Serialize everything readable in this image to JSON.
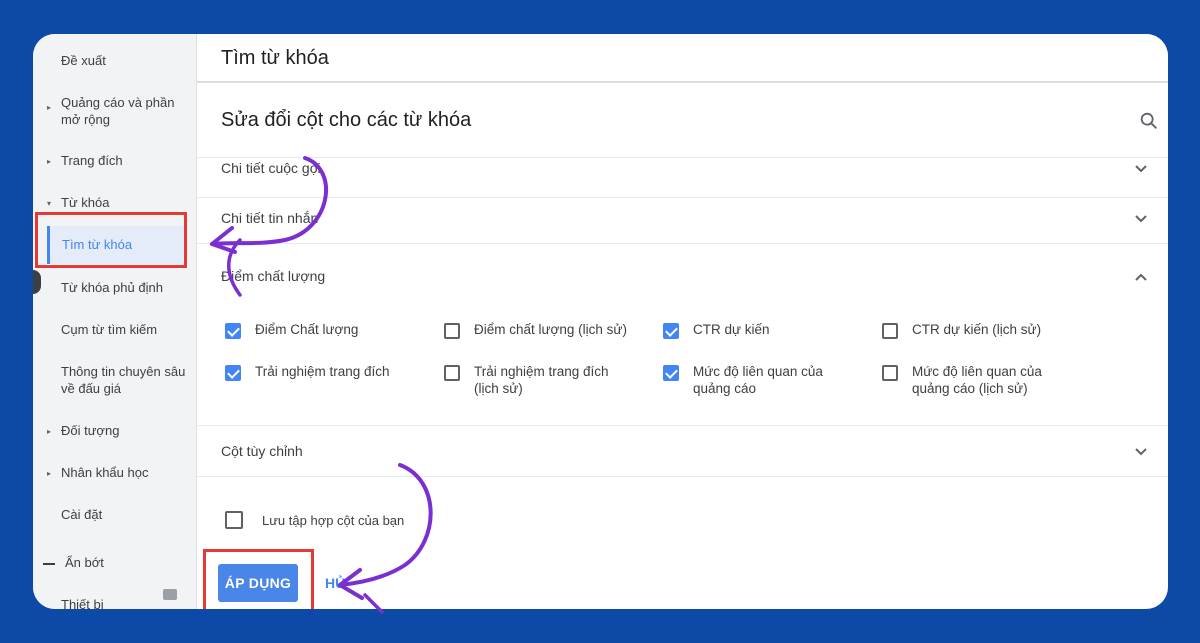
{
  "sidebar": {
    "items": [
      {
        "label": "Đề xuất",
        "arrow": ""
      },
      {
        "label": "Quảng cáo và phần mở rộng",
        "arrow": "▸"
      },
      {
        "label": "Trang đích",
        "arrow": "▸"
      },
      {
        "label": "Từ khóa",
        "arrow": "▾"
      },
      {
        "label": "Từ khóa phủ định",
        "arrow": ""
      },
      {
        "label": "Cụm từ tìm kiếm",
        "arrow": ""
      },
      {
        "label": "Thông tin chuyên sâu về đấu giá",
        "arrow": ""
      },
      {
        "label": "Đối tượng",
        "arrow": "▸"
      },
      {
        "label": "Nhân khẩu học",
        "arrow": "▸"
      },
      {
        "label": "Cài đặt",
        "arrow": ""
      }
    ],
    "active_item": "Tìm từ khóa",
    "hide_label": "Ẩn bớt",
    "partial_item": "Thiết bị"
  },
  "topbar": {
    "title": "Tìm từ khóa"
  },
  "panel": {
    "title": "Sửa đổi cột cho các từ khóa",
    "sections": {
      "call_details": "Chi tiết cuộc gọi",
      "message_details": "Chi tiết tin nhắn",
      "quality_score": "Điểm chất lượng",
      "custom_columns": "Cột tùy chỉnh"
    },
    "options": [
      {
        "label": "Điểm Chất lượng",
        "checked": true
      },
      {
        "label": "Điểm chất lượng (lịch sử)",
        "checked": false
      },
      {
        "label": "CTR dự kiến",
        "checked": true
      },
      {
        "label": "CTR dự kiến (lịch sử)",
        "checked": false
      },
      {
        "label": "Trải nghiệm trang đích",
        "checked": true
      },
      {
        "label": "Trải nghiệm trang đích (lịch sử)",
        "checked": false
      },
      {
        "label": "Mức độ liên quan của quảng cáo",
        "checked": true
      },
      {
        "label": "Mức độ liên quan của quảng cáo (lịch sử)",
        "checked": false
      }
    ],
    "save_set_label": "Lưu tập hợp cột của bạn",
    "apply_label": "ÁP DỤNG",
    "cancel_label": "HỦ"
  },
  "colors": {
    "background": "#0d4aa8",
    "accent": "#4285f4",
    "highlight_box": "#e53935",
    "annotation_arrow": "#7b2fd0"
  }
}
